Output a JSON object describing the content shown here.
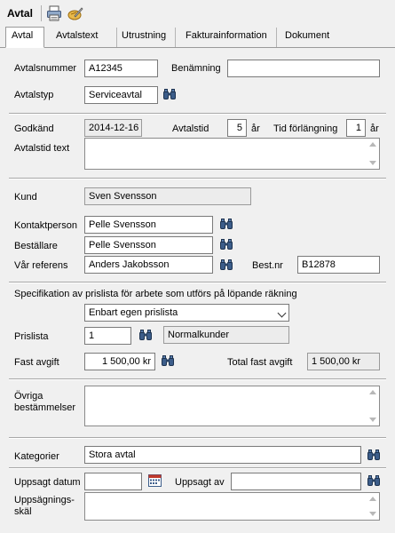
{
  "window": {
    "title": "Avtal"
  },
  "tabs": [
    {
      "label": "Avtal"
    },
    {
      "label": "Avtalstext"
    },
    {
      "label": "Utrustning"
    },
    {
      "label": "Fakturainformation"
    },
    {
      "label": "Dokument"
    }
  ],
  "form": {
    "avtalsnummer_label": "Avtalsnummer",
    "avtalsnummer_value": "A12345",
    "benamning_label": "Benämning",
    "benamning_value": "",
    "avtalstyp_label": "Avtalstyp",
    "avtalstyp_value": "Serviceavtal",
    "godkand_label": "Godkänd",
    "godkand_value": "2014-12-16",
    "avtalstid_label": "Avtalstid",
    "avtalstid_value": "5",
    "avtalstid_unit": "år",
    "tid_forlangning_label": "Tid förlängning",
    "tid_forlangning_value": "1",
    "tid_forlangning_unit": "år",
    "avtalstid_text_label": "Avtalstid text",
    "kund_label": "Kund",
    "kund_value": "Sven Svensson",
    "kontaktperson_label": "Kontaktperson",
    "kontaktperson_value": "Pelle Svensson",
    "bestallare_label": "Beställare",
    "bestallare_value": "Pelle Svensson",
    "var_referens_label": "Vår referens",
    "var_referens_value": "Anders Jakobsson",
    "best_nr_label": "Best.nr",
    "best_nr_value": "B12878",
    "specifikation_label": "Specifikation av prislista för arbete som utförs på löpande räkning",
    "prislista_option": "Enbart egen prislista",
    "prislista_label": "Prislista",
    "prislista_value": "1",
    "prislista_name": "Normalkunder",
    "fast_avgift_label": "Fast avgift",
    "fast_avgift_value": "1 500,00 kr",
    "total_fast_avgift_label": "Total fast avgift",
    "total_fast_avgift_value": "1 500,00 kr",
    "ovriga_label_1": "Övriga",
    "ovriga_label_2": "bestämmelser",
    "kategorier_label": "Kategorier",
    "kategorier_value": "Stora avtal",
    "uppsagt_datum_label": "Uppsagt datum",
    "uppsagt_datum_value": "",
    "uppsagt_av_label": "Uppsagt av",
    "uppsagt_av_value": "",
    "uppsagnings_label_1": "Uppsägnings-",
    "uppsagnings_label_2": "skäl"
  },
  "icons": {
    "print": "printer-icon",
    "tool": "pencil-icon",
    "lookup": "binoculars-icon",
    "calendar": "calendar-icon"
  }
}
